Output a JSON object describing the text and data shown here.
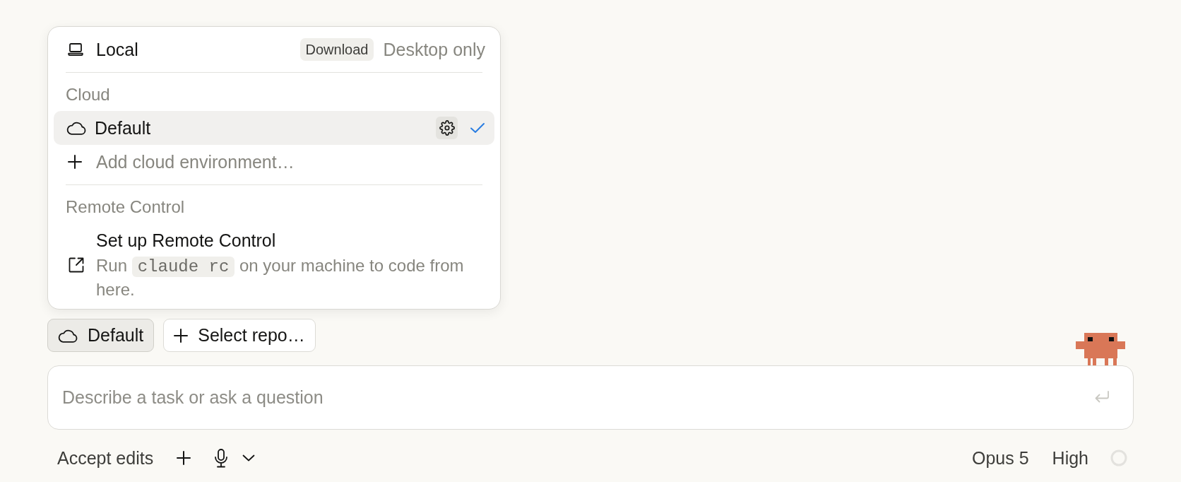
{
  "environment_menu": {
    "sections": [
      {
        "items": [
          {
            "kind": "local",
            "label": "Local",
            "badge": "Download",
            "note": "Desktop only",
            "selected": false
          }
        ]
      },
      {
        "heading": "Cloud",
        "items": [
          {
            "kind": "cloud",
            "label": "Default",
            "selected": true
          },
          {
            "kind": "add",
            "label": "Add cloud environment…"
          }
        ]
      },
      {
        "heading": "Remote Control",
        "items": [
          {
            "kind": "remote",
            "label": "Set up Remote Control",
            "description": [
              {
                "kind": "text",
                "text": "Run"
              },
              {
                "kind": "code",
                "text": "claude rc"
              },
              {
                "kind": "text",
                "text": "on your machine to code from here."
              }
            ]
          }
        ]
      }
    ]
  },
  "chips": [
    {
      "kind": "environment",
      "label": "Default",
      "active": true
    },
    {
      "kind": "repo",
      "label": "Select repo…",
      "active": false
    }
  ],
  "composer": {
    "placeholder": "Describe a task or ask a question",
    "send_disabled": true
  },
  "footer": {
    "mode": "Accept edits",
    "model": "Opus 5",
    "effort": "High"
  }
}
